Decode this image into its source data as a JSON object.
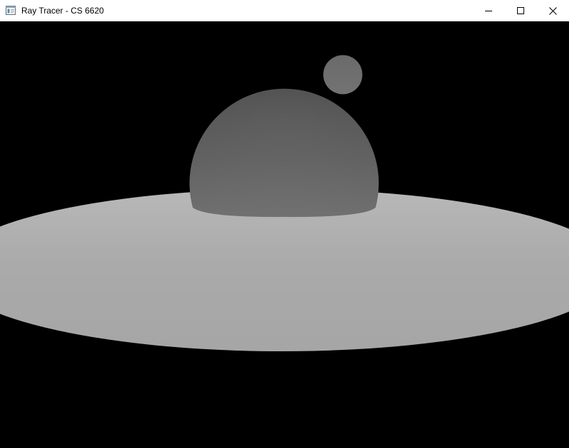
{
  "window": {
    "title": "Ray Tracer - CS 6620"
  },
  "icons": {
    "app": "app-window-icon",
    "minimize": "minimize-icon",
    "maximize": "maximize-icon",
    "close": "close-icon"
  },
  "render": {
    "background_color": "#000000",
    "objects": [
      "plane",
      "large-sphere",
      "small-sphere"
    ]
  }
}
